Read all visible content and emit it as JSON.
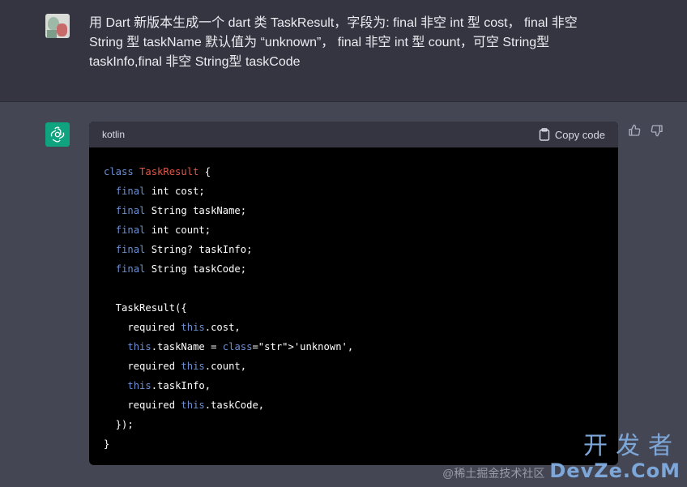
{
  "user_message": {
    "line1": "用 Dart 新版本生成一个 dart 类 TaskResult，字段为: final 非空 int 型 cost， final 非空",
    "line2": "String 型 taskName 默认值为 “unknown”， final 非空 int 型 count，可空 String型",
    "line3": "taskInfo,final 非空 String型 taskCode"
  },
  "code_block": {
    "language": "kotlin",
    "copy_label": "Copy code",
    "lines": [
      "class TaskResult {",
      "  final int cost;",
      "  final String taskName;",
      "  final int count;",
      "  final String? taskInfo;",
      "  final String taskCode;",
      "",
      "  TaskResult({",
      "    required this.cost,",
      "    this.taskName = 'unknown',",
      "    required this.count,",
      "    this.taskInfo,",
      "    required this.taskCode,",
      "  });",
      "}"
    ]
  },
  "icons": {
    "user_avatar": "user-avatar-photo",
    "assistant_avatar": "openai-logo-icon",
    "copy": "clipboard-icon",
    "thumbs_up": "thumbs-up-icon",
    "thumbs_down": "thumbs-down-icon"
  },
  "watermark": {
    "chinese": "开发者",
    "at": "@稀土掘金技术社区",
    "site": "DevZe.CoM"
  },
  "colors": {
    "user_bg": "#343541",
    "assistant_bg": "#444654",
    "code_bg": "#000000",
    "keyword": "#6d8fd1",
    "class_name": "#e0564a",
    "string": "#2ea860",
    "accent": "#10a37f"
  }
}
